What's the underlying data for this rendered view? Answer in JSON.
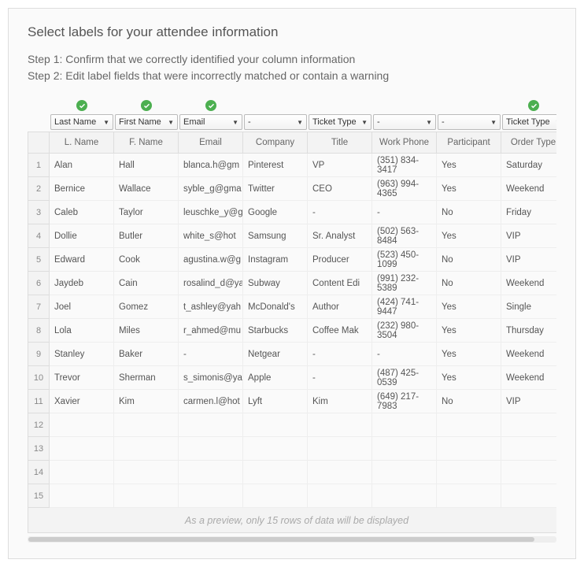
{
  "title": "Select labels for your attendee information",
  "steps": [
    "Step 1: Confirm that we correctly identified your column information",
    "Step 2: Edit label fields that were incorrectly matched or contain a warning"
  ],
  "columns": [
    {
      "check": true,
      "selector": "Last Name",
      "header": "L. Name"
    },
    {
      "check": true,
      "selector": "First Name",
      "header": "F. Name"
    },
    {
      "check": true,
      "selector": "Email",
      "header": "Email"
    },
    {
      "check": false,
      "selector": "-",
      "header": "Company"
    },
    {
      "check": false,
      "selector": "Ticket Type",
      "header": "Title"
    },
    {
      "check": false,
      "selector": "-",
      "header": "Work Phone"
    },
    {
      "check": false,
      "selector": "-",
      "header": "Participant"
    },
    {
      "check": true,
      "selector": "Ticket Type",
      "header": "Order Type"
    }
  ],
  "rows": [
    {
      "n": "1",
      "c": [
        "Alan",
        "Hall",
        "blanca.h@gm",
        "Pinterest",
        "VP",
        "(351) 834-3417",
        "Yes",
        "Saturday"
      ]
    },
    {
      "n": "2",
      "c": [
        "Bernice",
        "Wallace",
        "syble_g@gma",
        "Twitter",
        "CEO",
        "(963) 994-4365",
        "Yes",
        "Weekend"
      ]
    },
    {
      "n": "3",
      "c": [
        "Caleb",
        "Taylor",
        "leuschke_y@g",
        "Google",
        "-",
        "-",
        "No",
        "Friday"
      ]
    },
    {
      "n": "4",
      "c": [
        "Dollie",
        "Butler",
        "white_s@hot",
        "Samsung",
        "Sr. Analyst",
        "(502) 563-8484",
        "Yes",
        "VIP"
      ]
    },
    {
      "n": "5",
      "c": [
        "Edward",
        "Cook",
        "agustina.w@g",
        "Instagram",
        "Producer",
        "(523) 450-1099",
        "No",
        "VIP"
      ]
    },
    {
      "n": "6",
      "c": [
        "Jaydeb",
        "Cain",
        "rosalind_d@ya",
        "Subway",
        "Content Edi",
        "(991) 232-5389",
        "No",
        "Weekend"
      ]
    },
    {
      "n": "7",
      "c": [
        "Joel",
        "Gomez",
        "t_ashley@yah",
        "McDonald's",
        "Author",
        "(424) 741-9447",
        "Yes",
        "Single"
      ]
    },
    {
      "n": "8",
      "c": [
        "Lola",
        "Miles",
        "r_ahmed@mu",
        "Starbucks",
        "Coffee Mak",
        "(232) 980-3504",
        "Yes",
        "Thursday"
      ]
    },
    {
      "n": "9",
      "c": [
        "Stanley",
        "Baker",
        "-",
        "Netgear",
        "-",
        "-",
        "Yes",
        "Weekend"
      ]
    },
    {
      "n": "10",
      "c": [
        "Trevor",
        "Sherman",
        "s_simonis@ya",
        "Apple",
        "-",
        "(487) 425-0539",
        "Yes",
        "Weekend"
      ]
    },
    {
      "n": "11",
      "c": [
        "Xavier",
        "Kim",
        "carmen.l@hot",
        "Lyft",
        "Kim",
        "(649) 217-7983",
        "No",
        "VIP"
      ]
    },
    {
      "n": "12",
      "c": [
        "",
        "",
        "",
        "",
        "",
        "",
        "",
        ""
      ]
    },
    {
      "n": "13",
      "c": [
        "",
        "",
        "",
        "",
        "",
        "",
        "",
        ""
      ]
    },
    {
      "n": "14",
      "c": [
        "",
        "",
        "",
        "",
        "",
        "",
        "",
        ""
      ]
    },
    {
      "n": "15",
      "c": [
        "",
        "",
        "",
        "",
        "",
        "",
        "",
        ""
      ]
    }
  ],
  "footer": "As a preview, only 15 rows of data will be displayed"
}
